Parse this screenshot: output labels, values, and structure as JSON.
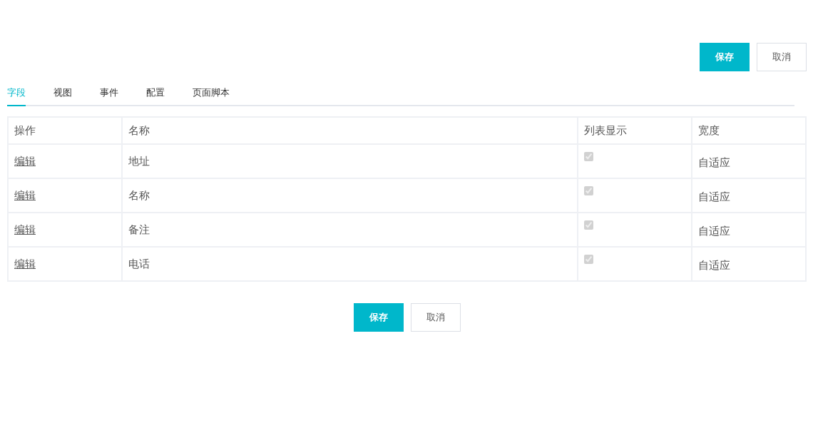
{
  "top_actions": [
    {
      "label": "保存",
      "kind": "primary"
    },
    {
      "label": "取消",
      "kind": "default"
    }
  ],
  "tabs": [
    {
      "label": "字段",
      "selected": true
    },
    {
      "label": "视图",
      "selected": false
    },
    {
      "label": "事件",
      "selected": false
    },
    {
      "label": "配置",
      "selected": false
    },
    {
      "label": "页面脚本",
      "selected": false
    }
  ],
  "table": {
    "columns": [
      "操作",
      "名称",
      "列表显示",
      "宽度"
    ],
    "rows": [
      {
        "action": "编辑",
        "name": "地址",
        "list_display": true,
        "width": "自适应"
      },
      {
        "action": "编辑",
        "name": "名称",
        "list_display": true,
        "width": "自适应"
      },
      {
        "action": "编辑",
        "name": "备注",
        "list_display": true,
        "width": "自适应"
      },
      {
        "action": "编辑",
        "name": "电话",
        "list_display": true,
        "width": "自适应"
      }
    ]
  },
  "bottom_actions": [
    {
      "label": "保存",
      "kind": "primary"
    },
    {
      "label": "取消",
      "kind": "default"
    }
  ]
}
